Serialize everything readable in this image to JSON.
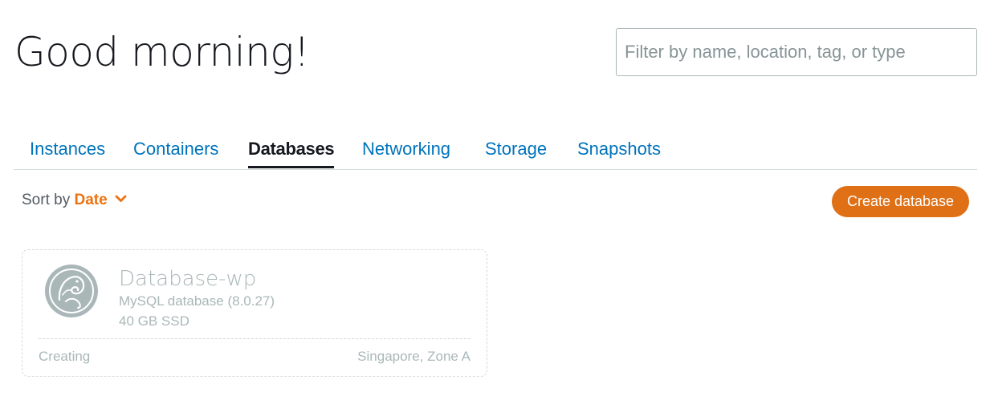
{
  "header": {
    "greeting": "Good morning!"
  },
  "filter": {
    "placeholder": "Filter by name, location, tag, or type",
    "value": ""
  },
  "tabs": [
    {
      "label": "Instances",
      "active": false
    },
    {
      "label": "Containers",
      "active": false
    },
    {
      "label": "Databases",
      "active": true
    },
    {
      "label": "Networking",
      "active": false
    },
    {
      "label": "Storage",
      "active": false
    },
    {
      "label": "Snapshots",
      "active": false
    }
  ],
  "sort": {
    "label": "Sort by",
    "value": "Date",
    "icon": "chevron-down-icon"
  },
  "actions": {
    "create_label": "Create database"
  },
  "databases": [
    {
      "name": "Database-wp",
      "engine": "MySQL database (8.0.27)",
      "storage": "40 GB SSD",
      "status": "Creating",
      "location": "Singapore, Zone A",
      "icon": "mysql-dolphin-icon"
    }
  ],
  "colors": {
    "accent": "#e07015",
    "sort_accent": "#ec7211",
    "link": "#0073bb",
    "text": "#16191f",
    "muted": "#aab7b8",
    "border": "#d5dbdb"
  }
}
